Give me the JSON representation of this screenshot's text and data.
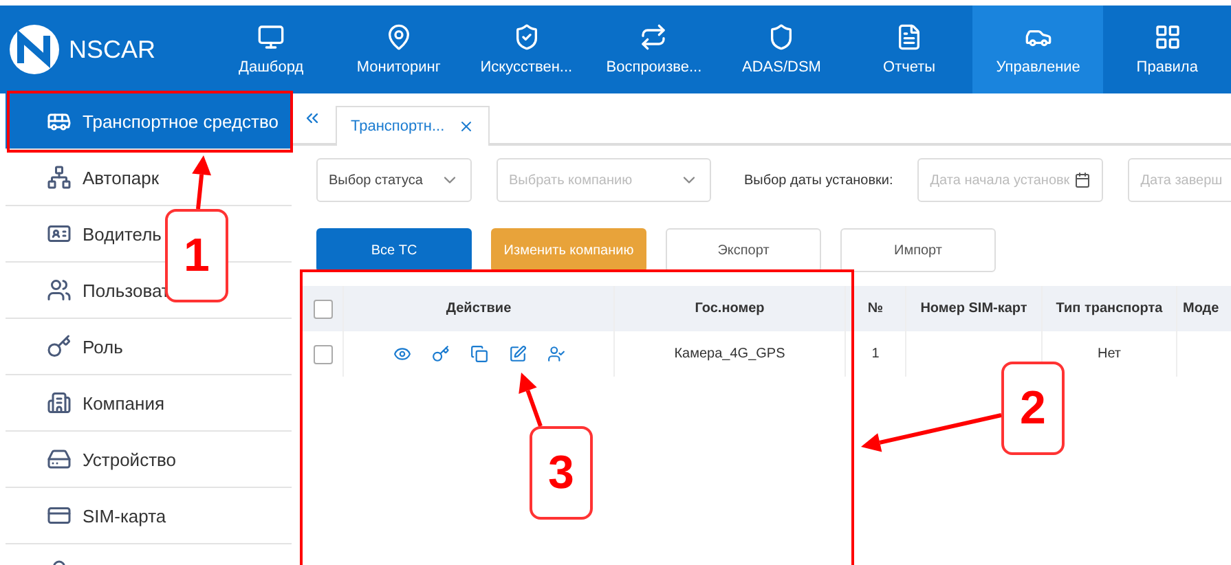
{
  "logo": {
    "text": "NSCAR"
  },
  "nav": [
    {
      "label": "Дашборд",
      "selected": false
    },
    {
      "label": "Мониторинг",
      "selected": false
    },
    {
      "label": "Искусствен...",
      "selected": false
    },
    {
      "label": "Воспроизве...",
      "selected": false
    },
    {
      "label": "ADAS/DSM",
      "selected": false
    },
    {
      "label": "Отчеты",
      "selected": false
    },
    {
      "label": "Управление",
      "selected": true
    },
    {
      "label": "Правила",
      "selected": false
    }
  ],
  "sidebar": {
    "items": [
      {
        "label": "Транспортное средство",
        "selected": true
      },
      {
        "label": "Автопарк",
        "selected": false
      },
      {
        "label": "Водитель",
        "selected": false
      },
      {
        "label": "Пользоват",
        "selected": false
      },
      {
        "label": "Роль",
        "selected": false
      },
      {
        "label": "Компания",
        "selected": false
      },
      {
        "label": "Устройство",
        "selected": false
      },
      {
        "label": "SIM-карта",
        "selected": false
      }
    ]
  },
  "tabs": [
    {
      "label": "Транспортн...",
      "selected": true
    }
  ],
  "filters": {
    "status": {
      "placeholder": "Выбор статуса"
    },
    "company": {
      "placeholder": "Выбрать компанию"
    },
    "date_label": "Выбор даты установки:",
    "date_start": {
      "placeholder": "Дата начала установк"
    },
    "date_end": {
      "placeholder": "Дата заверш"
    }
  },
  "buttons": [
    {
      "label": "Все ТС",
      "kind": "primary"
    },
    {
      "label": "Изменить компанию",
      "kind": "warning"
    },
    {
      "label": "Экспорт",
      "kind": "plain"
    },
    {
      "label": "Импорт",
      "kind": "plain"
    }
  ],
  "table": {
    "header_checked": false,
    "columns": [
      "Действие",
      "Гос.номер",
      "№",
      "Номер SIM-карт",
      "Тип транспорта",
      "Моде"
    ],
    "rows": [
      {
        "checked": false,
        "plate": "Камера_4G_GPS",
        "number": "1",
        "transport_type": "Нет"
      }
    ]
  },
  "annotations": [
    {
      "label": "1"
    },
    {
      "label": "2"
    },
    {
      "label": "3"
    }
  ]
}
